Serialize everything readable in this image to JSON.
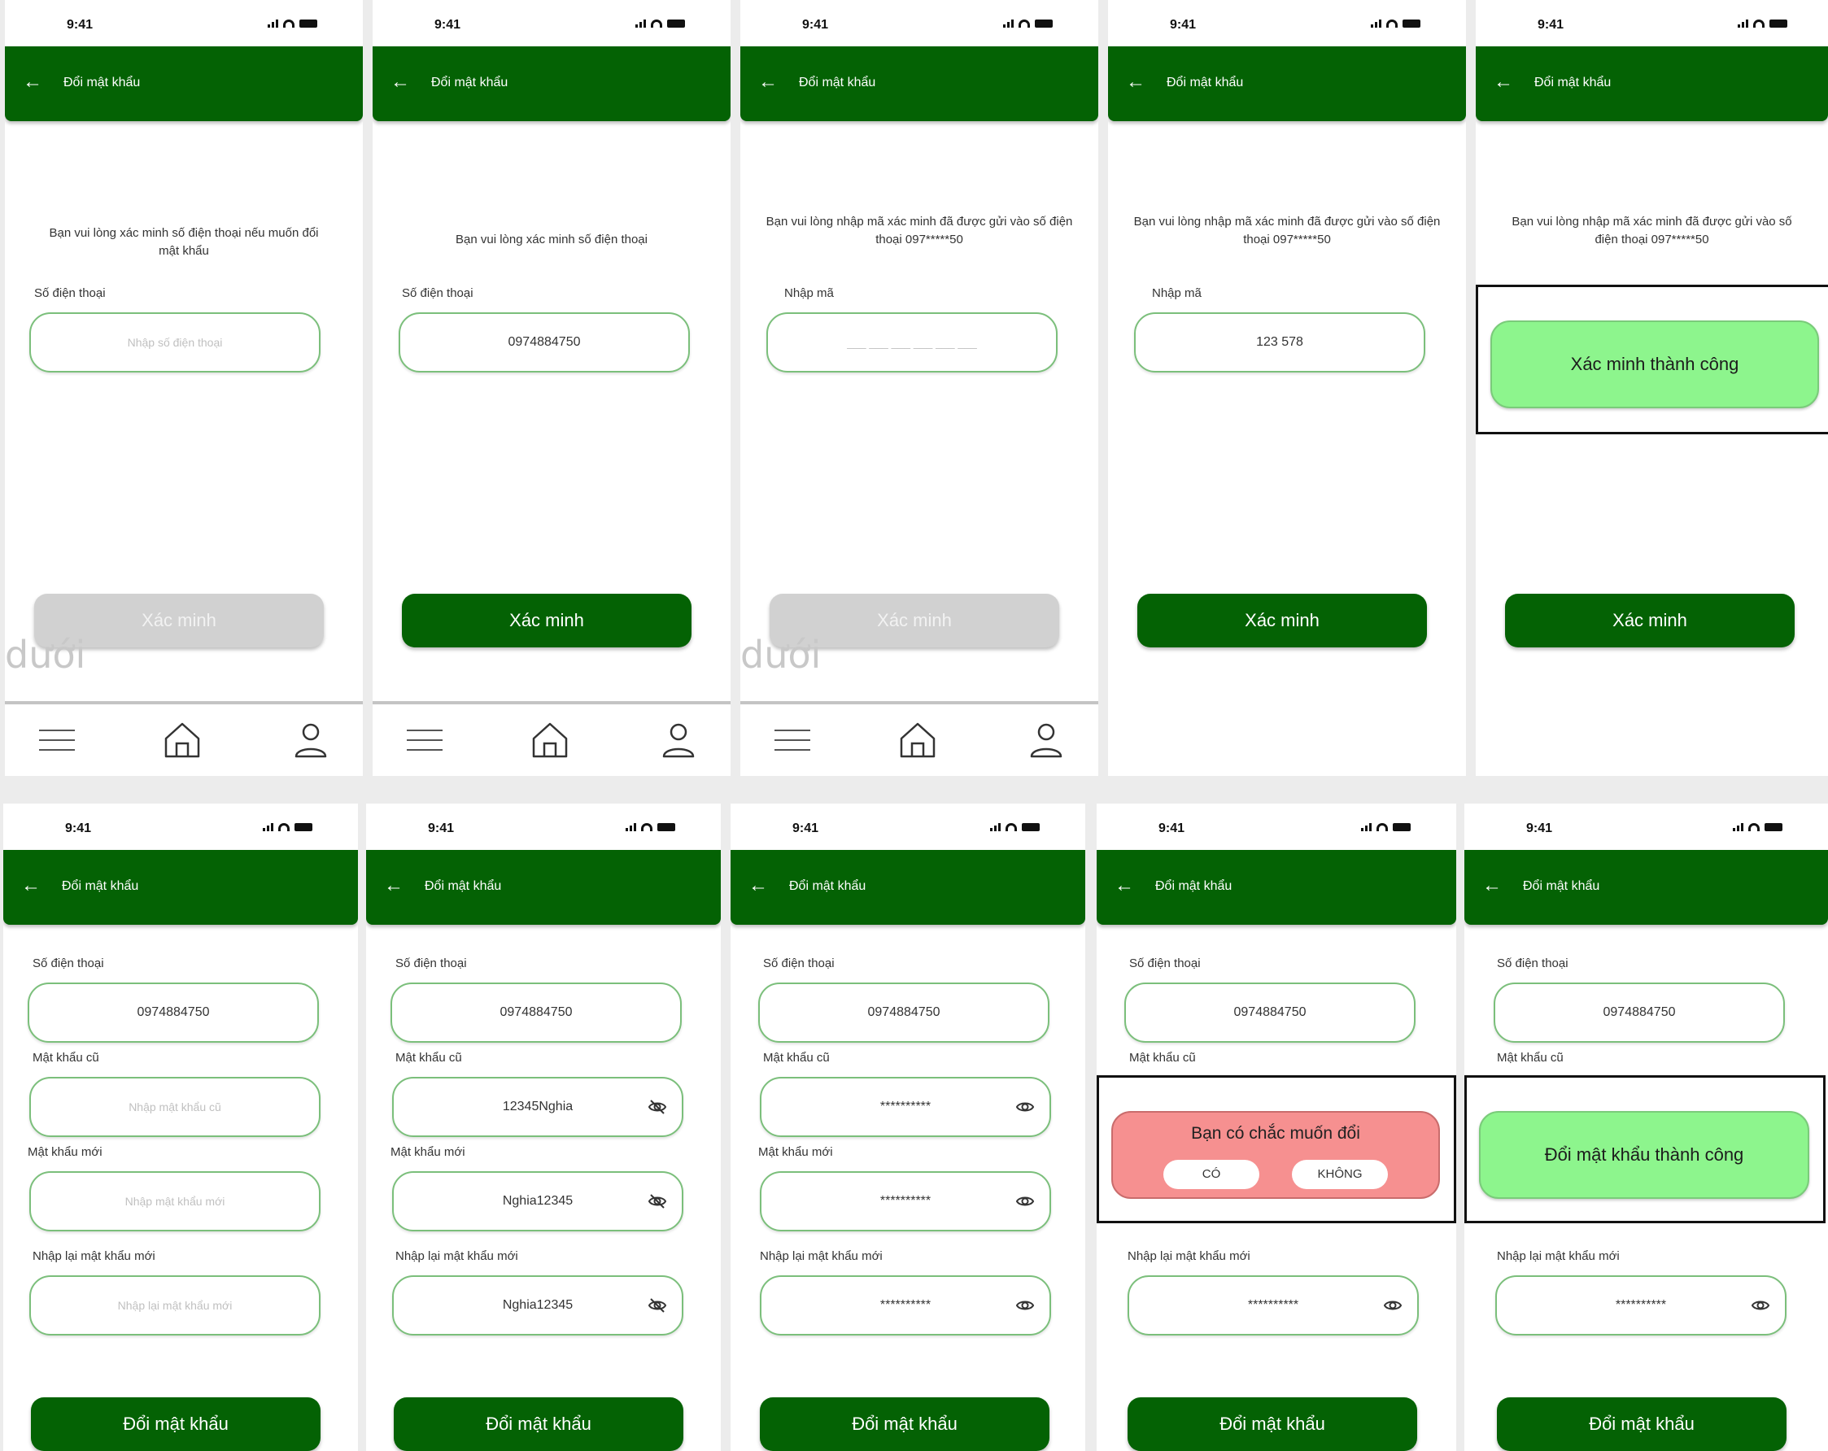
{
  "status": {
    "time": "9:41"
  },
  "appbar": {
    "title": "Đổi mật khẩu"
  },
  "top": {
    "s1": {
      "info": "Bạn vui lòng xác minh số điện thoại nếu muốn đổi mật khẩu",
      "phone_label": "Số điện thoại",
      "phone_placeholder": "Nhập số điện thoại",
      "button": "Xác minh",
      "ghost": "dưới"
    },
    "s2": {
      "info": "Bạn vui lòng xác minh số điện thoại",
      "phone_label": "Số điện thoại",
      "phone_value": "0974884750",
      "button": "Xác minh"
    },
    "s3": {
      "info": "Bạn vui lòng nhập mã xác minh đã được gửi vào số điện thoại 097*****50",
      "code_label": "Nhập mã",
      "code_placeholder": "___ ___ ___ ___ ___ ___",
      "button": "Xác minh",
      "ghost": "dưới"
    },
    "s4": {
      "info": "Bạn vui lòng nhập mã xác minh đã được gửi vào số điện thoại 097*****50",
      "code_label": "Nhập mã",
      "code_value": "123 578",
      "button": "Xác minh"
    },
    "s5": {
      "info": "Bạn vui lòng nhập mã xác minh đã được gửi vào số điện thoại 097*****50",
      "toast": "Xác minh thành công",
      "button": "Xác minh"
    }
  },
  "bottom": {
    "labels": {
      "phone": "Số điện thoại",
      "old": "Mật khẩu cũ",
      "new": "Mật khẩu mới",
      "confirm": "Nhập lại mật khẩu mới"
    },
    "phone_value": "0974884750",
    "button": "Đổi mật khẩu",
    "b1": {
      "old_placeholder": "Nhập mật khẩu cũ",
      "new_placeholder": "Nhập mật khẩu mới",
      "confirm_placeholder": "Nhập lại mật khẩu mới"
    },
    "b2": {
      "old_value": "12345Nghia",
      "new_value": "Nghia12345",
      "confirm_value": "Nghia12345"
    },
    "b3": {
      "old_value": "**********",
      "new_value": "**********",
      "confirm_value": "**********"
    },
    "b4": {
      "confirm_value": "**********",
      "dialog_title": "Bạn có chắc muốn đổi",
      "yes": "CÓ",
      "no": "KHÔNG"
    },
    "b5": {
      "confirm_value": "**********",
      "toast": "Đổi mật khẩu thành công"
    }
  },
  "icons": {
    "back": "arrow-left-icon",
    "menu": "menu-icon",
    "home": "home-icon",
    "profile": "user-icon",
    "eye": "eye-icon"
  },
  "colors": {
    "primary": "#046204",
    "field_border": "#7bbf7b",
    "success": "#8df58d",
    "danger": "#f69090",
    "disabled": "#d1d1d1"
  }
}
